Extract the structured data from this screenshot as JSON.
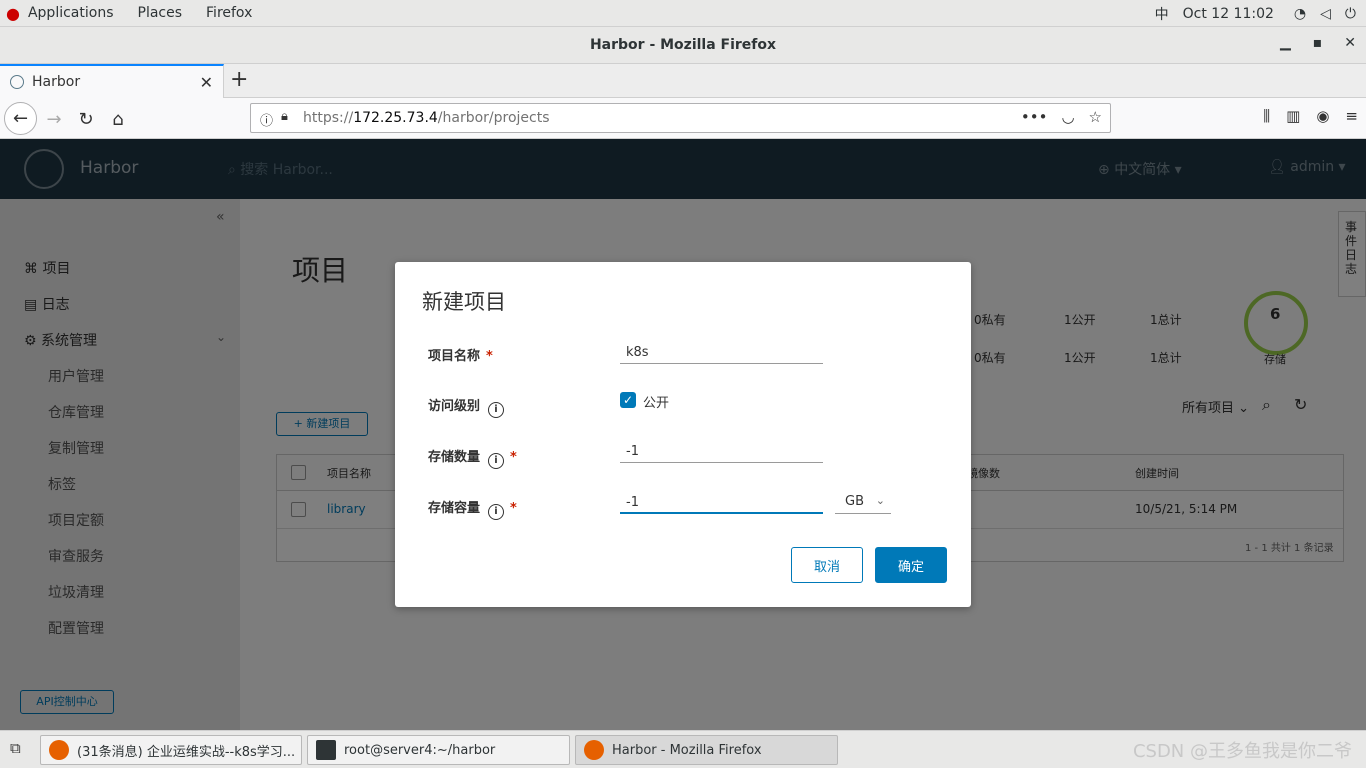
{
  "topbar": {
    "menus": [
      "Applications",
      "Places",
      "Firefox"
    ],
    "input_method": "中",
    "datetime": "Oct 12  11:02"
  },
  "window": {
    "title": "Harbor - Mozilla Firefox"
  },
  "tab": {
    "label": "Harbor"
  },
  "urlbar": {
    "prefix": "https://",
    "host": "172.25.73.4",
    "path": "/harbor/projects"
  },
  "harbor_header": {
    "brand": "Harbor",
    "search_placeholder": "搜索 Harbor...",
    "language": "中文简体",
    "user": "admin"
  },
  "sidebar": {
    "items": [
      "项目",
      "日志",
      "系统管理"
    ],
    "sub_items": [
      "用户管理",
      "仓库管理",
      "复制管理",
      "标签",
      "项目定额",
      "审查服务",
      "垃圾清理",
      "配置管理"
    ],
    "api_button": "API控制中心"
  },
  "main": {
    "title": "项目",
    "new_project_button": "+ 新建项目",
    "stats": {
      "private": "0私有",
      "public": "1公开",
      "total": "1总计",
      "storage_number": "6",
      "storage_label": "存储"
    },
    "filter": "所有项目",
    "table_headers": [
      "项目名称",
      "镜像数",
      "创建时间"
    ],
    "row": {
      "name": "library",
      "created": "10/5/21, 5:14 PM"
    },
    "footer": "1 - 1 共计 1 条记录",
    "event_log_tab": "事件日志"
  },
  "modal": {
    "title": "新建项目",
    "fields": {
      "name_label": "项目名称",
      "name_value": "k8s",
      "access_label": "访问级别",
      "public_label": "公开",
      "count_label": "存储数量",
      "count_value": "-1",
      "capacity_label": "存储容量",
      "capacity_value": "-1",
      "unit": "GB"
    },
    "cancel": "取消",
    "ok": "确定"
  },
  "taskbar": {
    "tasks": [
      "(31条消息) 企业运维实战--k8s学习...",
      "root@server4:~/harbor",
      "Harbor - Mozilla Firefox"
    ],
    "watermark": "CSDN @王多鱼我是你二爷"
  },
  "colors": {
    "primary": "#0079b8",
    "header": "#1f3645",
    "required": "#c92100"
  }
}
